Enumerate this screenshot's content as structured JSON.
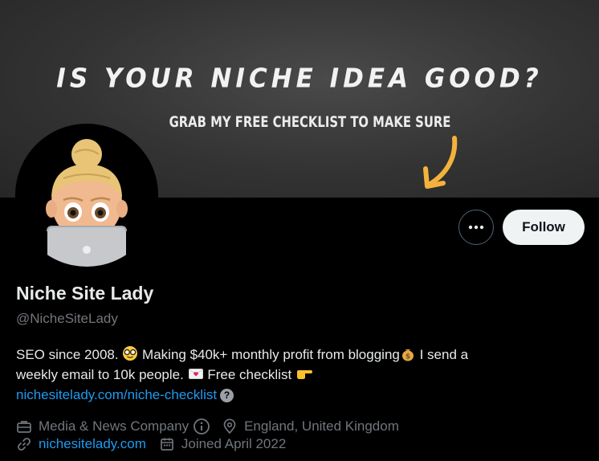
{
  "banner": {
    "headline": "IS YOUR NICHE IDEA GOOD?",
    "subline": "GRAB MY FREE CHECKLIST TO MAKE SURE"
  },
  "actions": {
    "more_label": "•••",
    "follow_label": "Follow"
  },
  "profile": {
    "name": "Niche Site Lady",
    "handle": "@NicheSiteLady",
    "bio_line1_a": "SEO since 2008.",
    "bio_line1_b": "Making $40k+ monthly profit from blogging",
    "bio_line1_c": "I send a",
    "bio_line2_a": "weekly email to 10k people.",
    "bio_line2_b": "Free checklist",
    "bio_link": "nichesitelady.com/niche-checklist"
  },
  "meta": {
    "category": "Media & News Company",
    "location": "England, United Kingdom",
    "website": "nichesitelady.com",
    "joined": "Joined April 2022"
  },
  "colors": {
    "link": "#1d9bf0",
    "muted": "#71767b",
    "text": "#e7e9ea",
    "background": "#000000"
  },
  "icons": [
    "more-icon",
    "info-icon",
    "briefcase-icon",
    "location-icon",
    "link-icon",
    "calendar-icon",
    "question-icon"
  ]
}
